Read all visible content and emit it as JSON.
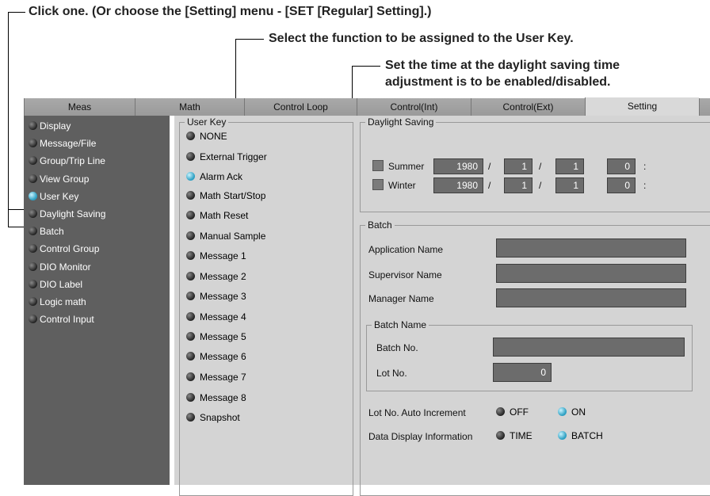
{
  "annotations": {
    "top": "Click one. (Or choose the [Setting] menu - [SET [Regular] Setting].)",
    "user_key": "Select the function to be assigned to the User Key.",
    "dst_line1": "Set the time at the daylight saving time",
    "dst_line2": "adjustment is to be enabled/disabled."
  },
  "tabs": [
    "Meas",
    "Math",
    "Control Loop",
    "Control(Int)",
    "Control(Ext)",
    "Setting"
  ],
  "active_tab": "Setting",
  "left_menu": [
    {
      "label": "Display",
      "selected": false
    },
    {
      "label": "Message/File",
      "selected": false
    },
    {
      "label": "Group/Trip Line",
      "selected": false
    },
    {
      "label": "View Group",
      "selected": false
    },
    {
      "label": "User Key",
      "selected": true
    },
    {
      "label": "Daylight Saving",
      "selected": false
    },
    {
      "label": "Batch",
      "selected": false
    },
    {
      "label": "Control Group",
      "selected": false
    },
    {
      "label": "DIO Monitor",
      "selected": false
    },
    {
      "label": "DIO Label",
      "selected": false
    },
    {
      "label": "Logic math",
      "selected": false
    },
    {
      "label": "Control Input",
      "selected": false
    }
  ],
  "user_key": {
    "title": "User Key",
    "options": [
      {
        "label": "NONE",
        "selected": false
      },
      {
        "label": "External Trigger",
        "selected": false
      },
      {
        "label": "Alarm Ack",
        "selected": true
      },
      {
        "label": "Math Start/Stop",
        "selected": false
      },
      {
        "label": "Math Reset",
        "selected": false
      },
      {
        "label": "Manual Sample",
        "selected": false
      },
      {
        "label": "Message 1",
        "selected": false
      },
      {
        "label": "Message 2",
        "selected": false
      },
      {
        "label": "Message 3",
        "selected": false
      },
      {
        "label": "Message 4",
        "selected": false
      },
      {
        "label": "Message 5",
        "selected": false
      },
      {
        "label": "Message 6",
        "selected": false
      },
      {
        "label": "Message 7",
        "selected": false
      },
      {
        "label": "Message 8",
        "selected": false
      },
      {
        "label": "Snapshot",
        "selected": false
      }
    ]
  },
  "daylight_saving": {
    "title": "Daylight Saving",
    "summer": {
      "label": "Summer",
      "year": "1980",
      "month": "1",
      "day": "1",
      "hour": "0"
    },
    "winter": {
      "label": "Winter",
      "year": "1980",
      "month": "1",
      "day": "1",
      "hour": "0"
    },
    "sep_slash": "/",
    "sep_colon": ":"
  },
  "batch": {
    "title": "Batch",
    "application_name_label": "Application Name",
    "application_name": "",
    "supervisor_name_label": "Supervisor Name",
    "supervisor_name": "",
    "manager_name_label": "Manager Name",
    "manager_name": "",
    "batch_name_title": "Batch Name",
    "batch_no_label": "Batch No.",
    "batch_no": "",
    "lot_no_label": "Lot No.",
    "lot_no": "0",
    "lot_auto_label": "Lot No. Auto Increment",
    "lot_auto_off": "OFF",
    "lot_auto_on": "ON",
    "lot_auto_value": "ON",
    "display_info_label": "Data Display Information",
    "display_time": "TIME",
    "display_batch": "BATCH",
    "display_value": "BATCH"
  }
}
